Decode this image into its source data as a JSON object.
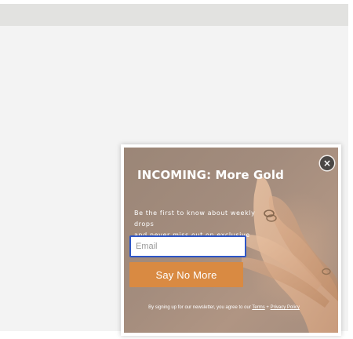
{
  "popup": {
    "headline": "INCOMING: More Gold",
    "subtext_line1": "Be the first to know about weekly drops",
    "subtext_line2": "and never miss out on exclusive offers.",
    "email_placeholder": "Email",
    "email_value": "",
    "submit_label": "Say No More",
    "close_glyph": "×",
    "disclaimer_prefix": "By signing up for our newsletter, you agree to our ",
    "terms_label": "Terms",
    "separator": " + ",
    "privacy_label": "Privacy Policy",
    "background_image": "hands-with-gold-rings-image",
    "close_icon": "close-icon"
  },
  "colors": {
    "button_orange": "#d98a42",
    "input_focus_border": "#2d56c7",
    "popup_tone": "#a38c7d",
    "close_bg": "#4a4745",
    "top_bar": "#e2e2e0",
    "content_bg": "#f3f3f3"
  }
}
